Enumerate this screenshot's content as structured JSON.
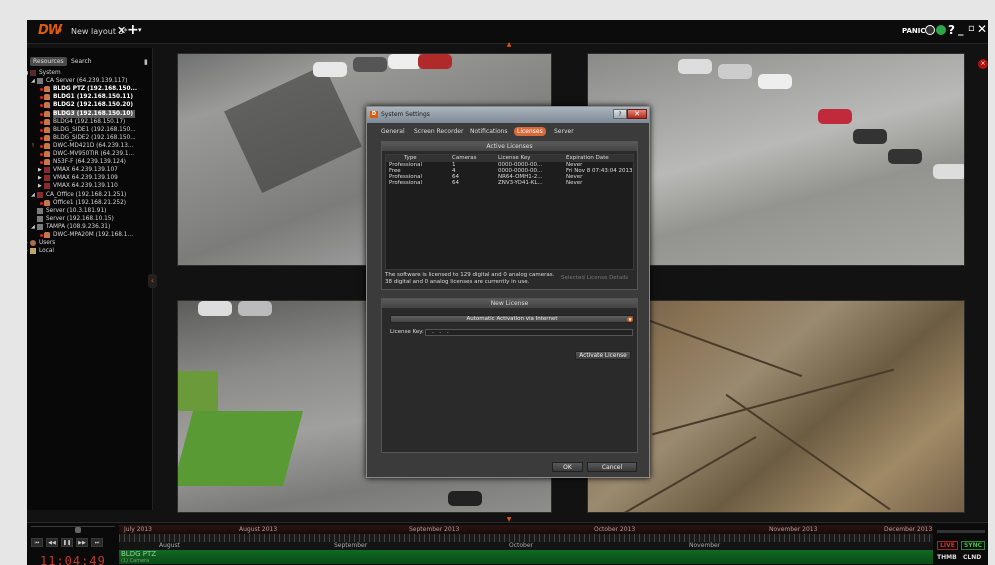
{
  "topbar": {
    "logo": "DW",
    "layout_tab": "New layout 3*",
    "close_glyph": "✕",
    "add_glyph": "+",
    "caret_glyph": "▾",
    "panic": "PANIC",
    "help": "?",
    "minimize": "_",
    "restore": "▫",
    "close_app": "✕"
  },
  "panel": {
    "tabs": [
      "Resources",
      "Search"
    ],
    "tree": [
      {
        "label": "System",
        "arrow": "◢",
        "icon": "sys"
      },
      {
        "label": "CA Server (64.239.139.117)",
        "arrow": "◢",
        "icon": "srv"
      },
      {
        "label": "BLDG PTZ (192.168.150...",
        "icon": "cam",
        "bold": true,
        "dot": true
      },
      {
        "label": "BLDG1 (192.168.150.11)",
        "icon": "cam",
        "bold": true,
        "dot": true
      },
      {
        "label": "BLDG2 (192.168.150.20)",
        "icon": "cam",
        "bold": true,
        "dot": true
      },
      {
        "label": "BLDG3 (192.168.150.10)",
        "icon": "cam",
        "bold": true,
        "dot": true,
        "selected": true
      },
      {
        "label": "BLDG4 (192.168.150.17)",
        "icon": "cam",
        "dot": true
      },
      {
        "label": "BLDG_SIDE1 (192.168.150...",
        "icon": "cam",
        "dot": true
      },
      {
        "label": "BLDG_SIDE2 (192.168.150...",
        "icon": "cam",
        "dot": true
      },
      {
        "label": "DWC-MD421D (64.239.13...",
        "icon": "cam",
        "dot": true,
        "warn": true
      },
      {
        "label": "DWC-MV950TIR (64.239.1...",
        "icon": "cam",
        "dot": true
      },
      {
        "label": "N53F-F (64.239.139.124)",
        "icon": "cam",
        "dot": true
      },
      {
        "label": "VMAX 64.239.139.107",
        "icon": "dvr",
        "arrow": "▶"
      },
      {
        "label": "VMAX 64.239.139.109",
        "icon": "dvr",
        "arrow": "▶"
      },
      {
        "label": "VMAX 64.239.139.110",
        "icon": "dvr",
        "arrow": "▶"
      },
      {
        "label": "CA_Office (192.168.21.251)",
        "icon": "dvr",
        "arrow": "◢"
      },
      {
        "label": "Office1 (192.168.21.252)",
        "icon": "cam",
        "dot": true
      },
      {
        "label": "Server (10.3.181.91)",
        "icon": "srv"
      },
      {
        "label": "Server (192.168.10.15)",
        "icon": "srv"
      },
      {
        "label": "TAMPA (108.9.236.31)",
        "icon": "srv",
        "arrow": "◢"
      },
      {
        "label": "DWC-MPA20M (192.168.1...",
        "icon": "cam",
        "dot": true
      },
      {
        "label": "Users",
        "icon": "usr",
        "arrow": "▶"
      },
      {
        "label": "Local",
        "icon": "loc",
        "arrow": "▶"
      }
    ]
  },
  "timeline": {
    "months_top": [
      "July 2013",
      "August 2013",
      "September 2013",
      "October 2013",
      "November 2013",
      "December 2013"
    ],
    "months_sub": [
      "August",
      "September",
      "October",
      "November"
    ],
    "camera": "BLDG PTZ",
    "camera_count": "(1) Camera",
    "clock": "11:04:49",
    "live": "LIVE",
    "sync": "SYNC",
    "thmb": "THMB",
    "clnd": "CLND"
  },
  "dialog": {
    "title": "System Settings",
    "help": "?",
    "close": "✕",
    "tabs": [
      "General",
      "Screen Recorder",
      "Notifications",
      "Licenses",
      "Server"
    ],
    "active_tab": 3,
    "active_licenses": {
      "header": "Active Licenses",
      "columns": [
        "Type",
        "Cameras",
        "License Key",
        "Expiration Date"
      ],
      "rows": [
        [
          "Professional",
          "1",
          "0000-0000-00...",
          "Never"
        ],
        [
          "Free",
          "4",
          "0000-0000-00...",
          "Fri Nov 8 07:43:04 2013"
        ],
        [
          "Professional",
          "64",
          "NR64-OMH1-2...",
          "Never"
        ],
        [
          "Professional",
          "64",
          "ZNV3-YO41-KL...",
          "Never"
        ]
      ],
      "note_line1": "The software is licensed to 129 digital and 0 analog cameras.",
      "note_line2": "38 digital and 0 analog licenses are currently in use.",
      "selected_details": "Selected License Details"
    },
    "new_license": {
      "header": "New License",
      "method": "Automatic Activation via Internet",
      "key_label": "License Key:",
      "key_value": "- - -",
      "activate": "Activate License"
    },
    "ok": "OK",
    "cancel": "Cancel"
  }
}
